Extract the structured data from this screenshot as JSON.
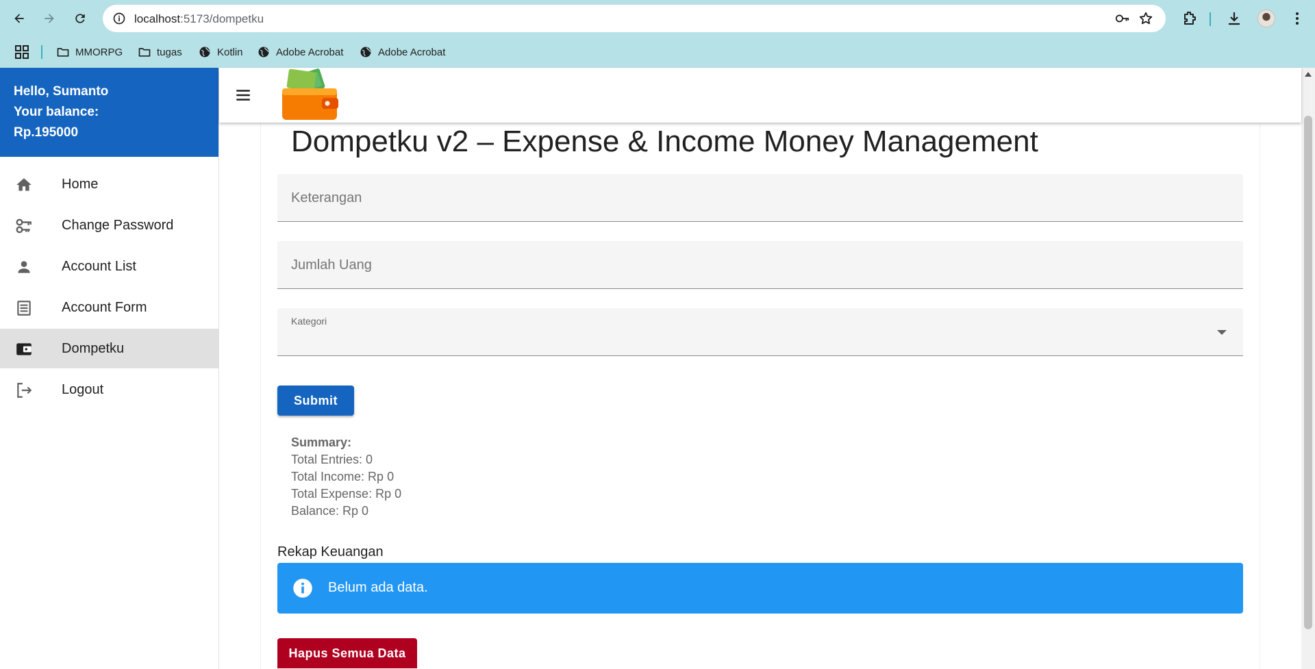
{
  "browser": {
    "url_host": "localhost",
    "url_path": ":5173/dompetku",
    "bookmarks": [
      {
        "label": "MMORPG",
        "icon": "folder-icon"
      },
      {
        "label": "tugas",
        "icon": "folder-icon"
      },
      {
        "label": "Kotlin",
        "icon": "globe-icon"
      },
      {
        "label": "Adobe Acrobat",
        "icon": "globe-icon"
      },
      {
        "label": "Adobe Acrobat",
        "icon": "globe-icon"
      }
    ]
  },
  "sidebar": {
    "greeting": "Hello, Sumanto",
    "balance_label": "Your balance:",
    "balance_value": "Rp.195000",
    "items": [
      {
        "label": "Home",
        "icon": "home-icon"
      },
      {
        "label": "Change Password",
        "icon": "key-icon"
      },
      {
        "label": "Account List",
        "icon": "person-icon"
      },
      {
        "label": "Account Form",
        "icon": "form-icon"
      },
      {
        "label": "Dompetku",
        "icon": "wallet-icon",
        "active": true
      },
      {
        "label": "Logout",
        "icon": "logout-icon"
      }
    ]
  },
  "main": {
    "title": "Dompetku v2 – Expense & Income Money Management",
    "fields": {
      "keterangan": "Keterangan",
      "jumlah": "Jumlah Uang",
      "kategori": "Kategori"
    },
    "submit_label": "Submit",
    "summary": {
      "title": "Summary:",
      "entries": "Total Entries: 0",
      "income": "Total Income: Rp 0",
      "expense": "Total Expense: Rp 0",
      "balance": "Balance: Rp 0"
    },
    "rekap_title": "Rekap Keuangan",
    "alert_text": "Belum ada data.",
    "delete_all_label": "Hapus Semua Data"
  },
  "colors": {
    "chrome_bg": "#b6e1e6",
    "drawer_header": "#1565c0",
    "primary": "#1565c0",
    "info": "#2196f3",
    "danger": "#b00020"
  }
}
